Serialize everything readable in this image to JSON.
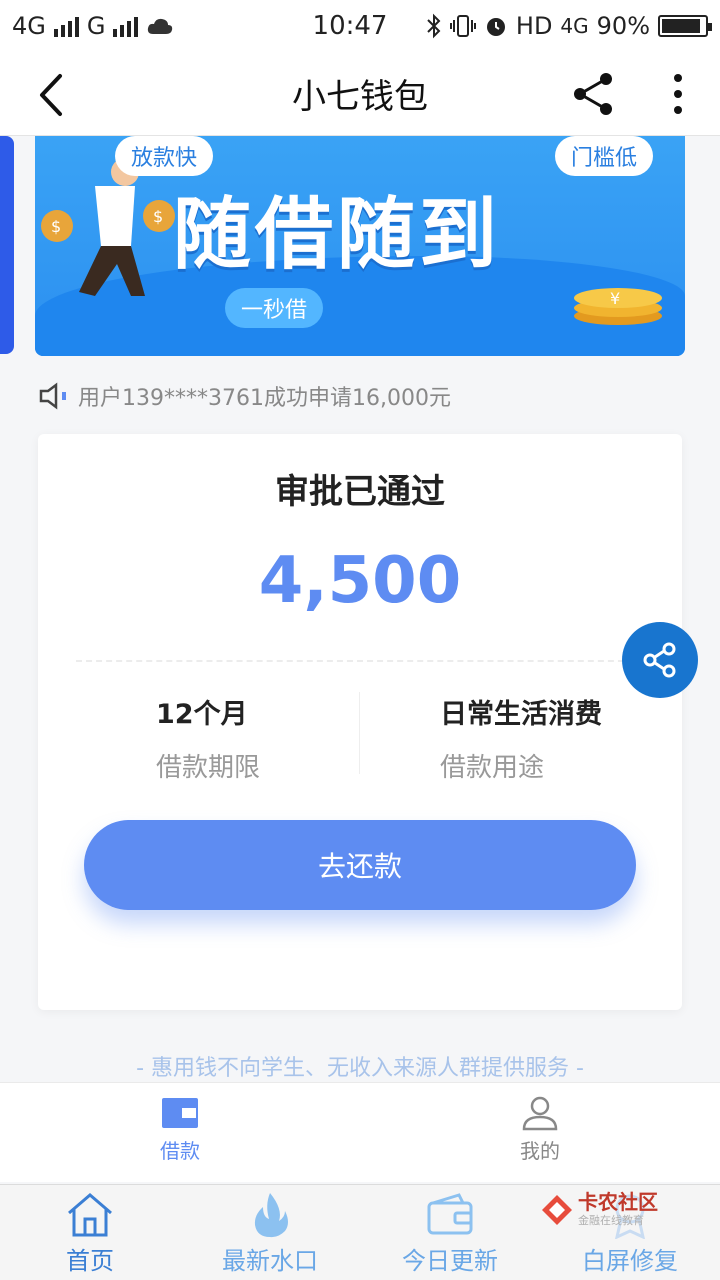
{
  "status_bar": {
    "left_network_1": "4G",
    "left_network_2": "G",
    "time": "10:47",
    "hd_label": "HD",
    "right_network": "4G",
    "battery_text": "90%",
    "battery_level": 0.9
  },
  "nav": {
    "title": "小七钱包",
    "back_icon": "chevron-left-icon",
    "share_icon": "share-icon",
    "more_icon": "more-vertical-icon"
  },
  "banner": {
    "title": "随借随到",
    "tag_fast": "放款快",
    "tag_low": "门槛低",
    "tag_second": "一秒借"
  },
  "notice": {
    "icon": "speaker-icon",
    "text": "用户139****3761成功申请16,000元"
  },
  "card": {
    "status": "审批已通过",
    "amount": "4,500",
    "term_value": "12个月",
    "term_label": "借款期限",
    "purpose_value": "日常生活消费",
    "purpose_label": "借款用途",
    "repay_button": "去还款"
  },
  "disclaimer": "- 惠用钱不向学生、无收入来源人群提供服务 -",
  "inner_tabs": [
    {
      "label": "借款",
      "icon": "wallet-icon",
      "active": true
    },
    {
      "label": "我的",
      "icon": "user-icon",
      "active": false
    }
  ],
  "outer_tabs": [
    {
      "label": "首页",
      "icon": "home-icon"
    },
    {
      "label": "最新水口",
      "icon": "flame-icon"
    },
    {
      "label": "今日更新",
      "icon": "wallet-icon"
    },
    {
      "label": "白屏修复",
      "icon": "badge-icon"
    }
  ],
  "watermark": {
    "title": "卡农社区",
    "subtitle": "金融在线教育"
  },
  "colors": {
    "accent": "#5e8cf2",
    "float_share": "#1875cf",
    "banner": "#2b8ff0"
  }
}
